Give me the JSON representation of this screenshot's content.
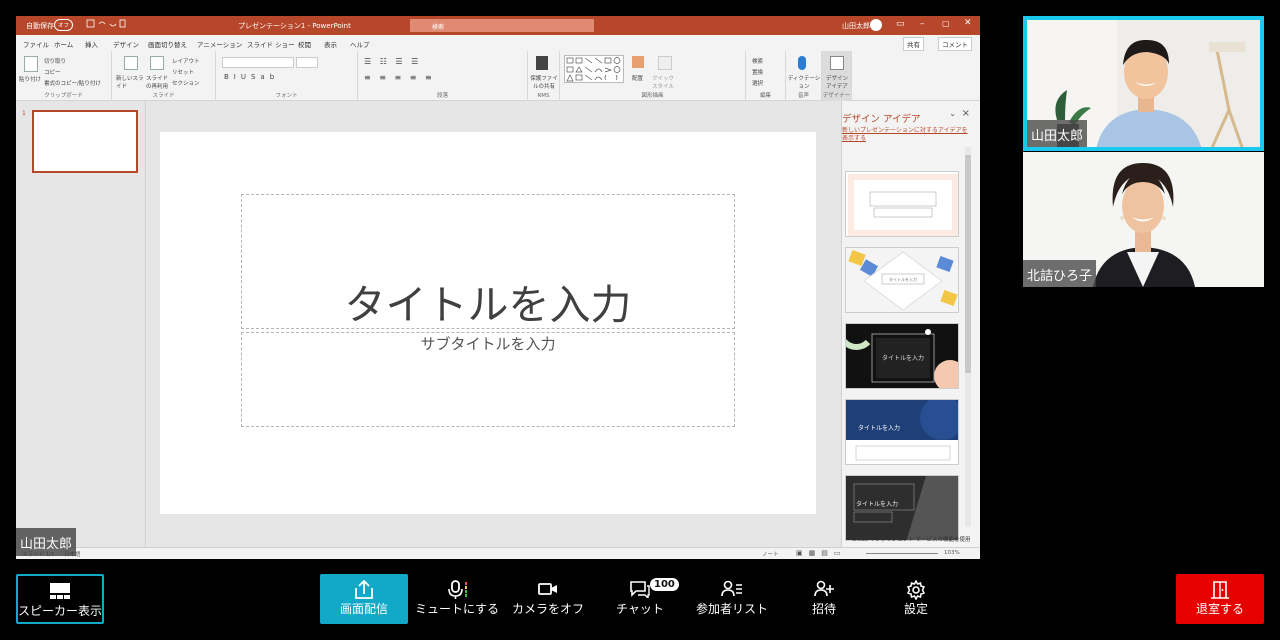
{
  "powerpoint": {
    "autosave_label": "自動保存",
    "autosave_state": "オフ",
    "window_title": "プレゼンテーション1 - PowerPoint",
    "search_placeholder": "検索",
    "user_name": "山田太郎",
    "tabs": [
      "ファイル",
      "ホーム",
      "挿入",
      "デザイン",
      "画面切り替え",
      "アニメーション",
      "スライド ショー",
      "校閲",
      "表示",
      "ヘルプ"
    ],
    "share_label": "共有",
    "comment_label": "コメント",
    "ribbon_groups": [
      "クリップボード",
      "スライド",
      "フォント",
      "段落",
      "RMS",
      "図形描画",
      "編集",
      "音声",
      "デザイナー"
    ],
    "ribbon_items": {
      "paste": "貼り付け",
      "cut": "切り取り",
      "copy": "コピー",
      "format_painter": "書式のコピー/貼り付け",
      "new_slide": "新しいスライド",
      "reuse_slide": "スライドの再利用",
      "layout": "レイアウト",
      "reset": "リセット",
      "section": "セクション",
      "protect_file": "保護ファイルの共有",
      "arrange": "配置",
      "quick_styles": "クイック スタイル",
      "find": "検索",
      "replace": "置換",
      "select": "選択",
      "dictate": "ディクテーション",
      "design_ideas": "デザイン アイデア"
    },
    "thumbnail_number": "1",
    "slide_title": "タイトルを入力",
    "slide_subtitle": "サブタイトルを入力",
    "design_pane_title": "デザイン アイデア",
    "design_pane_link": "新しいプレゼンテーションに対するアイデアを表示する",
    "design_pane_footer": "Office インテリジェント サービスの機能を使用",
    "design_thumb_title": "タイトルを入力",
    "status_slide": "スライド 1/1",
    "status_lang": "日本語",
    "status_notes": "ノート",
    "status_zoom": "103%"
  },
  "share_label": "山田太郎",
  "participants": [
    {
      "name": "山田太郎",
      "active_speaker": true
    },
    {
      "name": "北詰ひろ子",
      "active_speaker": false
    }
  ],
  "toolbar": {
    "speaker_view": "スピーカー表示",
    "screen_share": "画面配信",
    "mute": "ミュートにする",
    "camera_off": "カメラをオフ",
    "chat": "チャット",
    "chat_count": "100",
    "participants_list": "参加者リスト",
    "invite": "招待",
    "settings": "設定",
    "leave": "退室する"
  },
  "colors": {
    "pp_brand": "#b7472a",
    "accent": "#12a9c9",
    "active_speaker_border": "#19c9f0",
    "leave": "#e60000"
  }
}
